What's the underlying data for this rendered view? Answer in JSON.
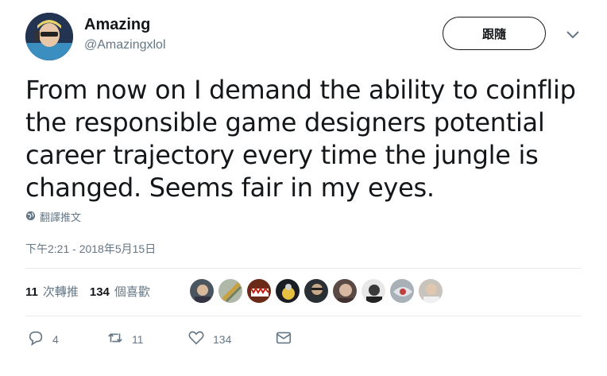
{
  "author": {
    "name": "Amazing",
    "handle": "@Amazingxlol"
  },
  "follow_label": "跟隨",
  "tweet_text": "From now on I demand the ability to coinflip the responsible game designers potential career trajectory every time the jungle is changed. Seems fair in my eyes.",
  "translate_label": "翻譯推文",
  "timestamp": "下午2:21 - 2018年5月15日",
  "stats": {
    "retweets_count": "11",
    "retweets_label": "次轉推",
    "likes_count": "134",
    "likes_label": "個喜歡"
  },
  "liker_avatars": [
    "#4a5560",
    "#b0b8a8",
    "#6b2a18",
    "#1a1e24",
    "#2b3035",
    "#5a4a45",
    "#3a3a3a",
    "#a8b0b8",
    "#c8c4bc"
  ],
  "actions": {
    "reply_count": "4",
    "retweet_count": "11",
    "like_count": "134"
  },
  "colors": {
    "text": "#14171a",
    "muted": "#657786",
    "divider": "#e6ecf0"
  }
}
